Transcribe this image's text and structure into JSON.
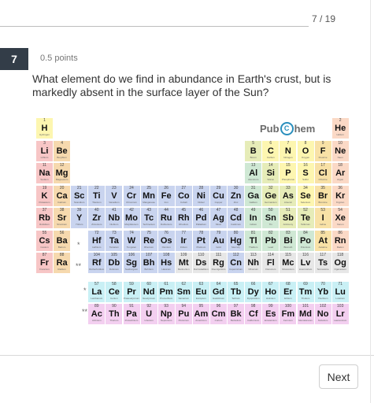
{
  "header": {
    "progress": "7 / 19"
  },
  "question": {
    "number": "7",
    "points": "0.5 points",
    "text": "What element do we find in abundance in Earth's crust, but is markedly absent in the surface layer of the Sun?"
  },
  "periodic_table": {
    "logo_left": "Pub",
    "logo_mid": "C",
    "logo_right": "hem",
    "placeholder_marks": [
      "*",
      "**",
      "*",
      "**"
    ],
    "category_colors": {
      "nonmetal": "#fdf6b0",
      "noble": "#fbd9c6",
      "alkali": "#f7c6c6",
      "alkaline": "#f6d9ae",
      "transition": "#c9d4ef",
      "post": "#cfe8d4",
      "metalloid": "#e6ecb8",
      "halogen": "#f8e1a6",
      "lanthanide": "#c9f0f5",
      "actinide": "#f3cff0",
      "unknown": "#e7e7e7"
    },
    "elements": [
      {
        "n": "1",
        "s": "H",
        "name": "Hydrogen",
        "r": 1,
        "c": 1,
        "cat": "nonmetal"
      },
      {
        "n": "2",
        "s": "He",
        "name": "Helium",
        "r": 1,
        "c": 18,
        "cat": "noble"
      },
      {
        "n": "3",
        "s": "Li",
        "name": "Lithium",
        "r": 2,
        "c": 1,
        "cat": "alkali"
      },
      {
        "n": "4",
        "s": "Be",
        "name": "Beryllium",
        "r": 2,
        "c": 2,
        "cat": "alkaline"
      },
      {
        "n": "5",
        "s": "B",
        "name": "Boron",
        "r": 2,
        "c": 13,
        "cat": "metalloid"
      },
      {
        "n": "6",
        "s": "C",
        "name": "Carbon",
        "r": 2,
        "c": 14,
        "cat": "nonmetal"
      },
      {
        "n": "7",
        "s": "N",
        "name": "Nitrogen",
        "r": 2,
        "c": 15,
        "cat": "nonmetal"
      },
      {
        "n": "8",
        "s": "O",
        "name": "Oxygen",
        "r": 2,
        "c": 16,
        "cat": "nonmetal"
      },
      {
        "n": "9",
        "s": "F",
        "name": "Fluorine",
        "r": 2,
        "c": 17,
        "cat": "halogen"
      },
      {
        "n": "10",
        "s": "Ne",
        "name": "Neon",
        "r": 2,
        "c": 18,
        "cat": "noble"
      },
      {
        "n": "11",
        "s": "Na",
        "name": "Sodium",
        "r": 3,
        "c": 1,
        "cat": "alkali"
      },
      {
        "n": "12",
        "s": "Mg",
        "name": "Magnesium",
        "r": 3,
        "c": 2,
        "cat": "alkaline"
      },
      {
        "n": "13",
        "s": "Al",
        "name": "Aluminum",
        "r": 3,
        "c": 13,
        "cat": "post"
      },
      {
        "n": "14",
        "s": "Si",
        "name": "Silicon",
        "r": 3,
        "c": 14,
        "cat": "metalloid"
      },
      {
        "n": "15",
        "s": "P",
        "name": "Phosphorus",
        "r": 3,
        "c": 15,
        "cat": "nonmetal"
      },
      {
        "n": "16",
        "s": "S",
        "name": "Sulfur",
        "r": 3,
        "c": 16,
        "cat": "nonmetal"
      },
      {
        "n": "17",
        "s": "Cl",
        "name": "Chlorine",
        "r": 3,
        "c": 17,
        "cat": "halogen"
      },
      {
        "n": "18",
        "s": "Ar",
        "name": "Argon",
        "r": 3,
        "c": 18,
        "cat": "noble"
      },
      {
        "n": "19",
        "s": "K",
        "name": "Potassium",
        "r": 4,
        "c": 1,
        "cat": "alkali"
      },
      {
        "n": "20",
        "s": "Ca",
        "name": "Calcium",
        "r": 4,
        "c": 2,
        "cat": "alkaline"
      },
      {
        "n": "21",
        "s": "Sc",
        "name": "Scandium",
        "r": 4,
        "c": 3,
        "cat": "transition"
      },
      {
        "n": "22",
        "s": "Ti",
        "name": "Titanium",
        "r": 4,
        "c": 4,
        "cat": "transition"
      },
      {
        "n": "23",
        "s": "V",
        "name": "Vanadium",
        "r": 4,
        "c": 5,
        "cat": "transition"
      },
      {
        "n": "24",
        "s": "Cr",
        "name": "Chromium",
        "r": 4,
        "c": 6,
        "cat": "transition"
      },
      {
        "n": "25",
        "s": "Mn",
        "name": "Manganese",
        "r": 4,
        "c": 7,
        "cat": "transition"
      },
      {
        "n": "26",
        "s": "Fe",
        "name": "Iron",
        "r": 4,
        "c": 8,
        "cat": "transition"
      },
      {
        "n": "27",
        "s": "Co",
        "name": "Cobalt",
        "r": 4,
        "c": 9,
        "cat": "transition"
      },
      {
        "n": "28",
        "s": "Ni",
        "name": "Nickel",
        "r": 4,
        "c": 10,
        "cat": "transition"
      },
      {
        "n": "29",
        "s": "Cu",
        "name": "Copper",
        "r": 4,
        "c": 11,
        "cat": "transition"
      },
      {
        "n": "30",
        "s": "Zn",
        "name": "Zinc",
        "r": 4,
        "c": 12,
        "cat": "transition"
      },
      {
        "n": "31",
        "s": "Ga",
        "name": "Gallium",
        "r": 4,
        "c": 13,
        "cat": "post"
      },
      {
        "n": "32",
        "s": "Ge",
        "name": "Germanium",
        "r": 4,
        "c": 14,
        "cat": "metalloid"
      },
      {
        "n": "33",
        "s": "As",
        "name": "Arsenic",
        "r": 4,
        "c": 15,
        "cat": "metalloid"
      },
      {
        "n": "34",
        "s": "Se",
        "name": "Selenium",
        "r": 4,
        "c": 16,
        "cat": "nonmetal"
      },
      {
        "n": "35",
        "s": "Br",
        "name": "Bromine",
        "r": 4,
        "c": 17,
        "cat": "halogen"
      },
      {
        "n": "36",
        "s": "Kr",
        "name": "Krypton",
        "r": 4,
        "c": 18,
        "cat": "noble"
      },
      {
        "n": "37",
        "s": "Rb",
        "name": "Rubidium",
        "r": 5,
        "c": 1,
        "cat": "alkali"
      },
      {
        "n": "38",
        "s": "Sr",
        "name": "Strontium",
        "r": 5,
        "c": 2,
        "cat": "alkaline"
      },
      {
        "n": "39",
        "s": "Y",
        "name": "Yttrium",
        "r": 5,
        "c": 3,
        "cat": "transition"
      },
      {
        "n": "40",
        "s": "Zr",
        "name": "Zirconium",
        "r": 5,
        "c": 4,
        "cat": "transition"
      },
      {
        "n": "41",
        "s": "Nb",
        "name": "Niobium",
        "r": 5,
        "c": 5,
        "cat": "transition"
      },
      {
        "n": "42",
        "s": "Mo",
        "name": "Molybdenum",
        "r": 5,
        "c": 6,
        "cat": "transition"
      },
      {
        "n": "43",
        "s": "Tc",
        "name": "Technetium",
        "r": 5,
        "c": 7,
        "cat": "transition"
      },
      {
        "n": "44",
        "s": "Ru",
        "name": "Ruthenium",
        "r": 5,
        "c": 8,
        "cat": "transition"
      },
      {
        "n": "45",
        "s": "Rh",
        "name": "Rhodium",
        "r": 5,
        "c": 9,
        "cat": "transition"
      },
      {
        "n": "46",
        "s": "Pd",
        "name": "Palladium",
        "r": 5,
        "c": 10,
        "cat": "transition"
      },
      {
        "n": "47",
        "s": "Ag",
        "name": "Silver",
        "r": 5,
        "c": 11,
        "cat": "transition"
      },
      {
        "n": "48",
        "s": "Cd",
        "name": "Cadmium",
        "r": 5,
        "c": 12,
        "cat": "transition"
      },
      {
        "n": "49",
        "s": "In",
        "name": "Indium",
        "r": 5,
        "c": 13,
        "cat": "post"
      },
      {
        "n": "50",
        "s": "Sn",
        "name": "Tin",
        "r": 5,
        "c": 14,
        "cat": "post"
      },
      {
        "n": "51",
        "s": "Sb",
        "name": "Antimony",
        "r": 5,
        "c": 15,
        "cat": "metalloid"
      },
      {
        "n": "52",
        "s": "Te",
        "name": "Tellurium",
        "r": 5,
        "c": 16,
        "cat": "metalloid"
      },
      {
        "n": "53",
        "s": "I",
        "name": "Iodine",
        "r": 5,
        "c": 17,
        "cat": "halogen"
      },
      {
        "n": "54",
        "s": "Xe",
        "name": "Xenon",
        "r": 5,
        "c": 18,
        "cat": "noble"
      },
      {
        "n": "55",
        "s": "Cs",
        "name": "Cesium",
        "r": 6,
        "c": 1,
        "cat": "alkali"
      },
      {
        "n": "56",
        "s": "Ba",
        "name": "Barium",
        "r": 6,
        "c": 2,
        "cat": "alkaline"
      },
      {
        "n": "72",
        "s": "Hf",
        "name": "Hafnium",
        "r": 6,
        "c": 4,
        "cat": "transition"
      },
      {
        "n": "73",
        "s": "Ta",
        "name": "Tantalum",
        "r": 6,
        "c": 5,
        "cat": "transition"
      },
      {
        "n": "74",
        "s": "W",
        "name": "Tungsten",
        "r": 6,
        "c": 6,
        "cat": "transition"
      },
      {
        "n": "75",
        "s": "Re",
        "name": "Rhenium",
        "r": 6,
        "c": 7,
        "cat": "transition"
      },
      {
        "n": "76",
        "s": "Os",
        "name": "Osmium",
        "r": 6,
        "c": 8,
        "cat": "transition"
      },
      {
        "n": "77",
        "s": "Ir",
        "name": "Iridium",
        "r": 6,
        "c": 9,
        "cat": "transition"
      },
      {
        "n": "78",
        "s": "Pt",
        "name": "Platinum",
        "r": 6,
        "c": 10,
        "cat": "transition"
      },
      {
        "n": "79",
        "s": "Au",
        "name": "Gold",
        "r": 6,
        "c": 11,
        "cat": "transition"
      },
      {
        "n": "80",
        "s": "Hg",
        "name": "Mercury",
        "r": 6,
        "c": 12,
        "cat": "transition"
      },
      {
        "n": "81",
        "s": "Tl",
        "name": "Thallium",
        "r": 6,
        "c": 13,
        "cat": "post"
      },
      {
        "n": "82",
        "s": "Pb",
        "name": "Lead",
        "r": 6,
        "c": 14,
        "cat": "post"
      },
      {
        "n": "83",
        "s": "Bi",
        "name": "Bismuth",
        "r": 6,
        "c": 15,
        "cat": "post"
      },
      {
        "n": "84",
        "s": "Po",
        "name": "Polonium",
        "r": 6,
        "c": 16,
        "cat": "post"
      },
      {
        "n": "85",
        "s": "At",
        "name": "Astatine",
        "r": 6,
        "c": 17,
        "cat": "halogen"
      },
      {
        "n": "86",
        "s": "Rn",
        "name": "Radon",
        "r": 6,
        "c": 18,
        "cat": "noble"
      },
      {
        "n": "87",
        "s": "Fr",
        "name": "Francium",
        "r": 7,
        "c": 1,
        "cat": "alkali"
      },
      {
        "n": "88",
        "s": "Ra",
        "name": "Radium",
        "r": 7,
        "c": 2,
        "cat": "alkaline"
      },
      {
        "n": "104",
        "s": "Rf",
        "name": "Rutherfordium",
        "r": 7,
        "c": 4,
        "cat": "transition"
      },
      {
        "n": "105",
        "s": "Db",
        "name": "Dubnium",
        "r": 7,
        "c": 5,
        "cat": "transition"
      },
      {
        "n": "106",
        "s": "Sg",
        "name": "Seaborgium",
        "r": 7,
        "c": 6,
        "cat": "transition"
      },
      {
        "n": "107",
        "s": "Bh",
        "name": "Bohrium",
        "r": 7,
        "c": 7,
        "cat": "transition"
      },
      {
        "n": "108",
        "s": "Hs",
        "name": "Hassium",
        "r": 7,
        "c": 8,
        "cat": "transition"
      },
      {
        "n": "109",
        "s": "Mt",
        "name": "Meitnerium",
        "r": 7,
        "c": 9,
        "cat": "unknown"
      },
      {
        "n": "110",
        "s": "Ds",
        "name": "Darmstadtium",
        "r": 7,
        "c": 10,
        "cat": "unknown"
      },
      {
        "n": "111",
        "s": "Rg",
        "name": "Roentgenium",
        "r": 7,
        "c": 11,
        "cat": "unknown"
      },
      {
        "n": "112",
        "s": "Cn",
        "name": "Copernicium",
        "r": 7,
        "c": 12,
        "cat": "transition"
      },
      {
        "n": "113",
        "s": "Nh",
        "name": "Nihonium",
        "r": 7,
        "c": 13,
        "cat": "unknown"
      },
      {
        "n": "114",
        "s": "Fl",
        "name": "Flerovium",
        "r": 7,
        "c": 14,
        "cat": "unknown"
      },
      {
        "n": "115",
        "s": "Mc",
        "name": "Moscovium",
        "r": 7,
        "c": 15,
        "cat": "unknown"
      },
      {
        "n": "116",
        "s": "Lv",
        "name": "Livermorium",
        "r": 7,
        "c": 16,
        "cat": "unknown"
      },
      {
        "n": "117",
        "s": "Ts",
        "name": "Tennessine",
        "r": 7,
        "c": 17,
        "cat": "unknown"
      },
      {
        "n": "118",
        "s": "Og",
        "name": "Oganesson",
        "r": 7,
        "c": 18,
        "cat": "unknown"
      },
      {
        "n": "57",
        "s": "La",
        "name": "Lanthanum",
        "r": 9,
        "c": 4,
        "cat": "lanthanide"
      },
      {
        "n": "58",
        "s": "Ce",
        "name": "Cerium",
        "r": 9,
        "c": 5,
        "cat": "lanthanide"
      },
      {
        "n": "59",
        "s": "Pr",
        "name": "Praseodymium",
        "r": 9,
        "c": 6,
        "cat": "lanthanide"
      },
      {
        "n": "60",
        "s": "Nd",
        "name": "Neodymium",
        "r": 9,
        "c": 7,
        "cat": "lanthanide"
      },
      {
        "n": "61",
        "s": "Pm",
        "name": "Promethium",
        "r": 9,
        "c": 8,
        "cat": "lanthanide"
      },
      {
        "n": "62",
        "s": "Sm",
        "name": "Samarium",
        "r": 9,
        "c": 9,
        "cat": "lanthanide"
      },
      {
        "n": "63",
        "s": "Eu",
        "name": "Europium",
        "r": 9,
        "c": 10,
        "cat": "lanthanide"
      },
      {
        "n": "64",
        "s": "Gd",
        "name": "Gadolinium",
        "r": 9,
        "c": 11,
        "cat": "lanthanide"
      },
      {
        "n": "65",
        "s": "Tb",
        "name": "Terbium",
        "r": 9,
        "c": 12,
        "cat": "lanthanide"
      },
      {
        "n": "66",
        "s": "Dy",
        "name": "Dysprosium",
        "r": 9,
        "c": 13,
        "cat": "lanthanide"
      },
      {
        "n": "67",
        "s": "Ho",
        "name": "Holmium",
        "r": 9,
        "c": 14,
        "cat": "lanthanide"
      },
      {
        "n": "68",
        "s": "Er",
        "name": "Erbium",
        "r": 9,
        "c": 15,
        "cat": "lanthanide"
      },
      {
        "n": "69",
        "s": "Tm",
        "name": "Thulium",
        "r": 9,
        "c": 16,
        "cat": "lanthanide"
      },
      {
        "n": "70",
        "s": "Yb",
        "name": "Ytterbium",
        "r": 9,
        "c": 17,
        "cat": "lanthanide"
      },
      {
        "n": "71",
        "s": "Lu",
        "name": "Lutetium",
        "r": 9,
        "c": 18,
        "cat": "lanthanide"
      },
      {
        "n": "89",
        "s": "Ac",
        "name": "Actinium",
        "r": 10,
        "c": 4,
        "cat": "actinide"
      },
      {
        "n": "90",
        "s": "Th",
        "name": "Thorium",
        "r": 10,
        "c": 5,
        "cat": "actinide"
      },
      {
        "n": "91",
        "s": "Pa",
        "name": "Protactinium",
        "r": 10,
        "c": 6,
        "cat": "actinide"
      },
      {
        "n": "92",
        "s": "U",
        "name": "Uranium",
        "r": 10,
        "c": 7,
        "cat": "actinide"
      },
      {
        "n": "93",
        "s": "Np",
        "name": "Neptunium",
        "r": 10,
        "c": 8,
        "cat": "actinide"
      },
      {
        "n": "94",
        "s": "Pu",
        "name": "Plutonium",
        "r": 10,
        "c": 9,
        "cat": "actinide"
      },
      {
        "n": "95",
        "s": "Am",
        "name": "Americium",
        "r": 10,
        "c": 10,
        "cat": "actinide"
      },
      {
        "n": "96",
        "s": "Cm",
        "name": "Curium",
        "r": 10,
        "c": 11,
        "cat": "actinide"
      },
      {
        "n": "97",
        "s": "Bk",
        "name": "Berkelium",
        "r": 10,
        "c": 12,
        "cat": "actinide"
      },
      {
        "n": "98",
        "s": "Cf",
        "name": "Californium",
        "r": 10,
        "c": 13,
        "cat": "actinide"
      },
      {
        "n": "99",
        "s": "Es",
        "name": "Einsteinium",
        "r": 10,
        "c": 14,
        "cat": "actinide"
      },
      {
        "n": "100",
        "s": "Fm",
        "name": "Fermium",
        "r": 10,
        "c": 15,
        "cat": "actinide"
      },
      {
        "n": "101",
        "s": "Md",
        "name": "Mendelevium",
        "r": 10,
        "c": 16,
        "cat": "actinide"
      },
      {
        "n": "102",
        "s": "No",
        "name": "Nobelium",
        "r": 10,
        "c": 17,
        "cat": "actinide"
      },
      {
        "n": "103",
        "s": "Lr",
        "name": "Lawrencium",
        "r": 10,
        "c": 18,
        "cat": "actinide"
      }
    ]
  },
  "footer": {
    "next_label": "Next"
  }
}
